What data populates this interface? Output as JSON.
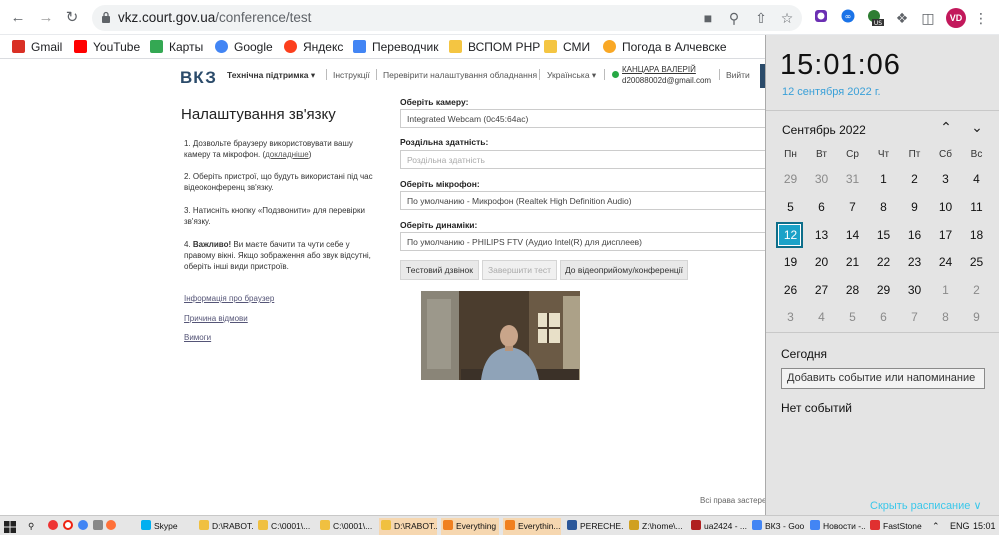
{
  "browser": {
    "url_host": "vkz.court.gov.ua",
    "url_path": "/conference/test",
    "avatar_initials": "VD",
    "ext_badge": "US",
    "bookmarks": [
      {
        "label": "Gmail",
        "color": "#d93025"
      },
      {
        "label": "YouTube",
        "color": "#ff0000"
      },
      {
        "label": "Карты",
        "color": "#34a853"
      },
      {
        "label": "Google",
        "color": "#4285f4"
      },
      {
        "label": "Яндекс",
        "color": "#fc3f1d"
      },
      {
        "label": "Переводчик",
        "color": "#4285f4"
      },
      {
        "label": "ВСПОМ РНР",
        "color": "#f4c542"
      },
      {
        "label": "СМИ",
        "color": "#f4c542"
      },
      {
        "label": "Погода в Алчевске",
        "color": "#f9a825"
      }
    ]
  },
  "site": {
    "logo": "ВКЗ",
    "nav": {
      "support": "Технічна підтримка ▾",
      "instructions": "Інструкції",
      "recheck": "Перевірити налаштування обладнання",
      "language": "Українська ▾",
      "user_name": "КАНЦАРА ВАЛЕРІЙ",
      "user_email": "d20088002d@gmail.com",
      "logout": "Вийти"
    },
    "title": "Налаштування зв'язку",
    "steps": [
      {
        "num": "1.",
        "text": "Дозвольте браузеру використовувати вашу камеру та мікрофон. (",
        "link": "докладніше",
        "tail": ")"
      },
      {
        "num": "2.",
        "text": "Оберіть пристрої, що будуть використані під час відеоконференц зв'язку."
      },
      {
        "num": "3.",
        "text": "Натисніть кнопку «Подзвонити» для перевірки зв'язку."
      },
      {
        "num": "4.",
        "bold": "Важливо!",
        "text": " Ви маєте бачити та чути себе у правому вікні. Якщо зображення або звук відсутні, оберіть інші види пристроїв."
      }
    ],
    "links": [
      "Інформація про браузер",
      "Причина відмови",
      "Вимоги"
    ],
    "fields": [
      {
        "label": "Оберіть камеру:",
        "value": "Integrated Webcam (0c45:64ac)",
        "placeholder": false
      },
      {
        "label": "Роздільна здатність:",
        "value": "Роздільна здатність",
        "placeholder": true
      },
      {
        "label": "Оберіть мікрофон:",
        "value": "По умолчанию - Микрофон (Realtek High Definition Audio)",
        "placeholder": false
      },
      {
        "label": "Оберіть динаміки:",
        "value": "По умолчанию - PHILIPS FTV (Аудио Intel(R) для дисплеев)",
        "placeholder": false
      }
    ],
    "buttons": {
      "test_call": "Тестовий дзвінок",
      "end_test": "Завершити тест",
      "to_conference": "До відеоприйому/конференції"
    },
    "footer": "Всі права застережено"
  },
  "clock": {
    "time": "15:01:06",
    "date": "12 сентября 2022 г.",
    "month": "Сентябрь 2022",
    "weekdays": [
      "Пн",
      "Вт",
      "Ср",
      "Чт",
      "Пт",
      "Сб",
      "Вс"
    ],
    "weeks": [
      [
        "29",
        "30",
        "31",
        "1",
        "2",
        "3",
        "4"
      ],
      [
        "5",
        "6",
        "7",
        "8",
        "9",
        "10",
        "11"
      ],
      [
        "12",
        "13",
        "14",
        "15",
        "16",
        "17",
        "18"
      ],
      [
        "19",
        "20",
        "21",
        "22",
        "23",
        "24",
        "25"
      ],
      [
        "26",
        "27",
        "28",
        "29",
        "30",
        "1",
        "2"
      ],
      [
        "3",
        "4",
        "5",
        "6",
        "7",
        "8",
        "9"
      ]
    ],
    "today_label": "Сегодня",
    "event_placeholder": "Добавить событие или напоминание",
    "no_events": "Нет событий",
    "hide_schedule": "Скрыть расписание ∨"
  },
  "taskbar": {
    "items": [
      {
        "label": "Skype",
        "color": "#00aff0",
        "active": false
      },
      {
        "label": "D:\\RABOT...",
        "color": "#f0c040",
        "active": false
      },
      {
        "label": "C:\\0001\\...",
        "color": "#f0c040",
        "active": false
      },
      {
        "label": "C:\\0001\\...",
        "color": "#f0c040",
        "active": false
      },
      {
        "label": "D:\\RABOT...",
        "color": "#f0c040",
        "active": true
      },
      {
        "label": "Everything",
        "color": "#f08020",
        "active": true
      },
      {
        "label": "Everythin...",
        "color": "#f08020",
        "active": true
      },
      {
        "label": "PERECHE...",
        "color": "#2b579a",
        "active": false
      },
      {
        "label": "Z:\\home\\...",
        "color": "#d0a020",
        "active": false
      },
      {
        "label": "ua2424 - ...",
        "color": "#b02020",
        "active": false
      },
      {
        "label": "ВКЗ - Goo...",
        "color": "#4285f4",
        "active": false
      },
      {
        "label": "Новости -...",
        "color": "#4285f4",
        "active": false
      },
      {
        "label": "FastStone",
        "color": "#e03030",
        "active": false
      }
    ],
    "lang": "ENG",
    "time": "15:01"
  }
}
